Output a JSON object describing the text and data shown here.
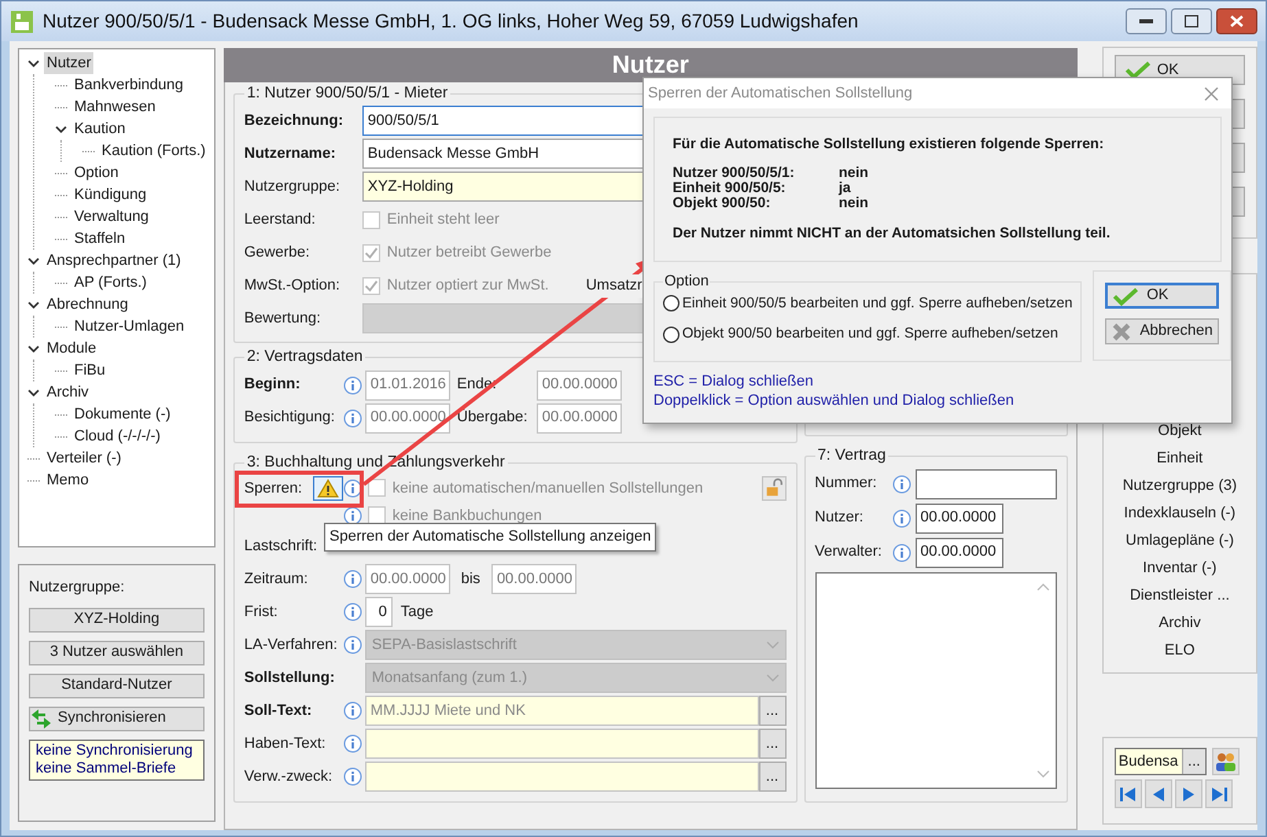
{
  "window": {
    "title": "Nutzer 900/50/5/1 - Budensack Messe GmbH, 1. OG links, Hoher Weg 59, 67059 Ludwigshafen"
  },
  "tree": [
    {
      "label": "Nutzer",
      "selected": true,
      "expanded": true,
      "children": [
        {
          "label": "Bankverbindung",
          "selected": false
        },
        {
          "label": "Mahnwesen",
          "selected": false
        },
        {
          "label": "Kaution",
          "selected": false,
          "expanded": true,
          "children": [
            {
              "label": "Kaution (Forts.)",
              "selected": false
            }
          ]
        },
        {
          "label": "Option",
          "selected": false
        },
        {
          "label": "Kündigung",
          "selected": false
        },
        {
          "label": "Verwaltung",
          "selected": false
        },
        {
          "label": "Staffeln",
          "selected": false
        }
      ]
    },
    {
      "label": "Ansprechpartner (1)",
      "selected": false,
      "expanded": true,
      "children": [
        {
          "label": "AP (Forts.)",
          "selected": false
        }
      ]
    },
    {
      "label": "Abrechnung",
      "selected": false,
      "expanded": true,
      "children": [
        {
          "label": "Nutzer-Umlagen",
          "selected": false
        }
      ]
    },
    {
      "label": "Module",
      "selected": false,
      "expanded": true,
      "children": [
        {
          "label": "FiBu",
          "selected": false
        }
      ]
    },
    {
      "label": "Archiv",
      "selected": false,
      "expanded": true,
      "children": [
        {
          "label": "Dokumente (-)",
          "selected": false
        },
        {
          "label": "Cloud (-/-/-/-)",
          "selected": false
        }
      ]
    },
    {
      "label": "Verteiler (-)",
      "selected": false
    },
    {
      "label": "Memo",
      "selected": false
    }
  ],
  "group_panel": {
    "label": "Nutzergruppe:",
    "buttons": [
      {
        "label": "XYZ-Holding",
        "kind": "plain"
      },
      {
        "label": "3 Nutzer auswählen",
        "kind": "plain"
      },
      {
        "label": "Standard-Nutzer",
        "kind": "plain"
      },
      {
        "label": "Synchronisieren",
        "kind": "sync"
      }
    ],
    "note": [
      "keine Synchronisierung",
      "keine Sammel-Briefe"
    ]
  },
  "header": {
    "title": "Nutzer"
  },
  "section1": {
    "legend": "1: Nutzer 900/50/5/1 - Mieter",
    "rows": [
      {
        "kind": "text",
        "label": "Bezeichnung:",
        "bold": true,
        "value": "900/50/5/1",
        "focused": true,
        "highlight": false
      },
      {
        "kind": "text",
        "label": "Nutzername:",
        "bold": true,
        "value": "Budensack Messe GmbH",
        "focused": false,
        "highlight": false
      },
      {
        "kind": "text",
        "label": "Nutzergruppe:",
        "bold": false,
        "value": "XYZ-Holding",
        "focused": false,
        "highlight": true
      },
      {
        "kind": "checkbox",
        "label": "Leerstand:",
        "text": "Einheit steht leer",
        "checked": false
      },
      {
        "kind": "checkbox",
        "label": "Gewerbe:",
        "text": "Nutzer betreibt Gewerbe",
        "checked": true
      },
      {
        "kind": "checkbox",
        "label": "MwSt.-Option:",
        "text": "Nutzer optiert zur MwSt.",
        "checked": true,
        "extra": "Umsatzr"
      },
      {
        "kind": "bar",
        "label": "Bewertung:"
      }
    ]
  },
  "section2": {
    "legend": "2: Vertragsdaten",
    "rows": [
      {
        "label": "Beginn:",
        "bold": true,
        "info": true,
        "value": "01.01.2016",
        "pairs": [
          {
            "label": "Ende:",
            "value": "00.00.0000"
          }
        ]
      },
      {
        "label": "Besichtigung:",
        "bold": false,
        "info": true,
        "value": "00.00.0000",
        "pairs": [
          {
            "label": "Übergabe:",
            "value": "00.00.0000"
          }
        ]
      }
    ]
  },
  "section3": {
    "legend": "3: Buchhaltung und Zahlungsverkehr",
    "rows": [
      {
        "kind": "lock",
        "label": "Sperren:",
        "bold": false,
        "info": true,
        "text": "keine automatischen/manuellen Sollstellungen",
        "checked": false
      },
      {
        "kind": "check",
        "info": true,
        "text": "keine Bankbuchungen",
        "checked": false
      },
      {
        "kind": "label",
        "label": "Lastschrift:",
        "bold": false,
        "info": false
      },
      {
        "kind": "range",
        "label": "Zeitraum:",
        "bold": false,
        "info": true,
        "from": "00.00.0000",
        "joiner": "bis",
        "to": "00.00.0000"
      },
      {
        "kind": "count",
        "label": "Frist:",
        "bold": false,
        "info": true,
        "value": "0",
        "unit": "Tage"
      },
      {
        "kind": "combo",
        "label": "LA-Verfahren:",
        "bold": false,
        "info": true,
        "value": "SEPA-Basislastschrift"
      },
      {
        "kind": "combo",
        "label": "Sollstellung:",
        "bold": true,
        "info": false,
        "value": "Monatsanfang (zum 1.)"
      },
      {
        "kind": "memo",
        "label": "Soll-Text:",
        "bold": true,
        "info": true,
        "value": "MM.JJJJ Miete und NK",
        "button": "..."
      },
      {
        "kind": "memo",
        "label": "Haben-Text:",
        "bold": false,
        "info": true,
        "button": "..."
      },
      {
        "kind": "memo",
        "label": "Verw.-zweck:",
        "bold": false,
        "info": true,
        "button": "..."
      }
    ]
  },
  "section7": {
    "legend": "7: Vertrag",
    "rows": [
      {
        "kind": "text",
        "label": "Nummer:"
      },
      {
        "kind": "date",
        "label": "Nutzer:",
        "value": "00.00.0000"
      },
      {
        "kind": "date",
        "label": "Verwalter:",
        "value": "00.00.0000"
      }
    ]
  },
  "side": {
    "buttons": [
      {
        "kind": "ok",
        "label": "OK"
      },
      {
        "kind": "blank"
      },
      {
        "kind": "blank"
      },
      {
        "kind": "blank"
      }
    ],
    "links": [
      "Objekt",
      "Einheit",
      "Nutzergruppe (3)",
      "Indexklauseln (-)",
      "Umlagepläne (-)",
      "Inventar (-)",
      "Dienstleister ...",
      "Archiv",
      "ELO"
    ],
    "search": {
      "value": "Budensa",
      "button": "..."
    },
    "nav": [
      {
        "kind": "first"
      },
      {
        "kind": "prev"
      },
      {
        "kind": "next"
      },
      {
        "kind": "last"
      }
    ]
  },
  "dialog": {
    "title": "Sperren der Automatischen Sollstellung",
    "heading": "Für die Automatische Sollstellung existieren folgende Sperren:",
    "rows": [
      {
        "label": "Nutzer 900/50/5/1:",
        "value": "nein"
      },
      {
        "label": "Einheit 900/50/5:",
        "value": "ja"
      },
      {
        "label": "Objekt 900/50:",
        "value": "nein"
      }
    ],
    "statement": "Der Nutzer nimmt NICHT an der Automatsichen Sollstellung teil.",
    "option_legend": "Option",
    "options": [
      {
        "label": "Einheit 900/50/5 bearbeiten und ggf. Sperre aufheben/setzen",
        "selected": false
      },
      {
        "label": "Objekt 900/50 bearbeiten und ggf. Sperre aufheben/setzen",
        "selected": false
      }
    ],
    "buttons": [
      {
        "kind": "ok",
        "label": "OK",
        "focused": true
      },
      {
        "kind": "cancel",
        "label": "Abbrechen",
        "focused": false
      }
    ],
    "hints": [
      "ESC = Dialog schließen",
      "Doppelklick = Option auswählen und Dialog schließen"
    ]
  },
  "tooltip": {
    "text": "Sperren der Automatische Sollstellung anzeigen"
  }
}
